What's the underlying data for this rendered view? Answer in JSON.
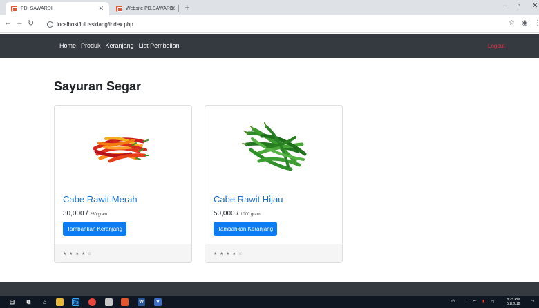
{
  "browser": {
    "tabs": [
      {
        "title": "PD. SAWARDI"
      },
      {
        "title": "Website PD.SAWARDI Sayur segar"
      }
    ],
    "url": "localhost/lulussidang/index.php"
  },
  "navbar": {
    "links": [
      "Home",
      "Produk",
      "Keranjang",
      "List Pembelian"
    ],
    "logout": "Logout"
  },
  "page": {
    "heading": "Sayuran Segar"
  },
  "products": [
    {
      "name": "Cabe Rawit Merah",
      "price": "30,000",
      "unit": "250 gram",
      "button": "Tambahkan Keranjang",
      "rating": "★ ★ ★ ★ ☆",
      "image_icon": "red-chili-icon"
    },
    {
      "name": "Cabe Rawit Hijau",
      "price": "50,000",
      "unit": "1000 gram",
      "button": "Tambahkan Keranjang",
      "rating": "★ ★ ★ ★ ☆",
      "image_icon": "green-chili-icon"
    }
  ],
  "taskbar": {
    "time": "8:25 PM",
    "date": "8/1/2018"
  },
  "colors": {
    "navbar": "#343a40",
    "primary": "#0d7bf2",
    "title_link": "#1a73c9",
    "logout": "#dc3545"
  }
}
